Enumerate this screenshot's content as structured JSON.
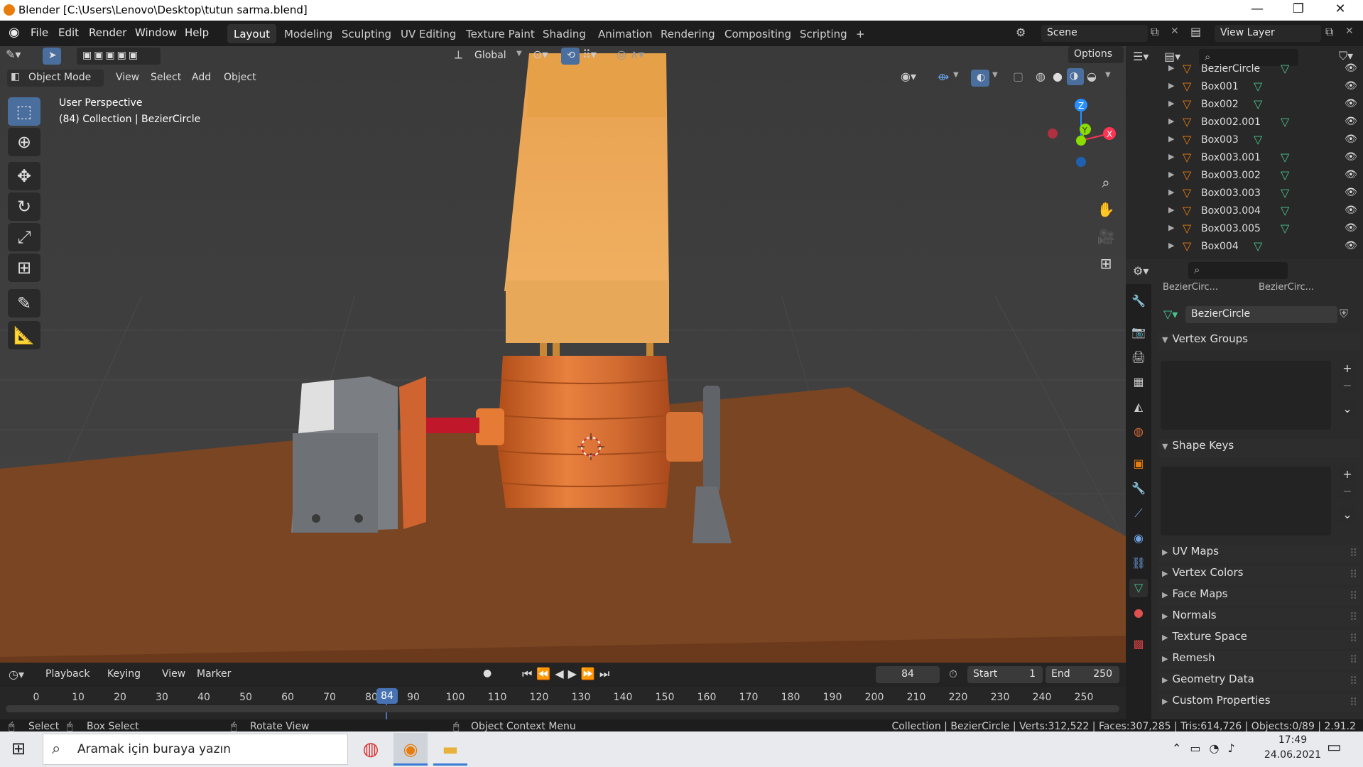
{
  "title_bar": {
    "title": "Blender [C:\\Users\\Lenovo\\Desktop\\tutun sarma.blend]",
    "minimize": "—",
    "maximize": "❐",
    "close": "✕"
  },
  "menu": {
    "items": [
      "File",
      "Edit",
      "Render",
      "Window",
      "Help"
    ]
  },
  "workspaces": [
    "Layout",
    "Modeling",
    "Sculpting",
    "UV Editing",
    "Texture Paint",
    "Shading",
    "Animation",
    "Rendering",
    "Compositing",
    "Scripting"
  ],
  "workspace_add": "+",
  "scene": {
    "name": "Scene",
    "view_layer": "View Layer"
  },
  "viewport": {
    "orientation": "Global",
    "options": "Options",
    "mode": "Object Mode",
    "menus": [
      "View",
      "Select",
      "Add",
      "Object"
    ],
    "info_line1": "User Perspective",
    "info_line2": "(84) Collection | BezierCircle",
    "gizmo": {
      "z": "Z",
      "x": "X",
      "y": "Y"
    }
  },
  "outliner": {
    "items": [
      "BezierCircle",
      "Box001",
      "Box002",
      "Box002.001",
      "Box003",
      "Box003.001",
      "Box003.002",
      "Box003.003",
      "Box003.004",
      "Box003.005",
      "Box004"
    ]
  },
  "properties": {
    "object_name": "BezierCircle",
    "data_name": "BezierCircle",
    "obj_breadcrumb": "BezierCirc...",
    "data_breadcrumb": "BezierCirc...",
    "panels": [
      "Vertex Groups",
      "Shape Keys"
    ],
    "collapsed": [
      "UV Maps",
      "Vertex Colors",
      "Face Maps",
      "Normals",
      "Texture Space",
      "Remesh",
      "Geometry Data",
      "Custom Properties"
    ]
  },
  "timeline": {
    "menus": [
      "Playback",
      "Keying",
      "View",
      "Marker"
    ],
    "current_frame": "84",
    "start_label": "Start",
    "start": "1",
    "end_label": "End",
    "end": "250",
    "ticks": [
      "0",
      "10",
      "20",
      "30",
      "40",
      "50",
      "60",
      "70",
      "80",
      "90",
      "100",
      "110",
      "120",
      "130",
      "140",
      "150",
      "160",
      "170",
      "180",
      "190",
      "200",
      "210",
      "220",
      "230",
      "240",
      "250"
    ],
    "playhead": "84"
  },
  "status": {
    "select": "Select",
    "box_select": "Box Select",
    "rotate": "Rotate View",
    "context": "Object Context Menu",
    "stats": "Collection | BezierCircle | Verts:312,522 | Faces:307,285 | Tris:614,726 | Objects:0/89 | 2.91.2"
  },
  "taskbar": {
    "search_placeholder": "Aramak için buraya yazın",
    "time": "17:49",
    "date": "24.06.2021"
  },
  "colors": {
    "accent": "#4772b3",
    "orange": "#e87d0d",
    "vertex_green": "#4cc38a",
    "gizmo_x": "#ff3352",
    "gizmo_y": "#8bdc00",
    "gizmo_z": "#2890ff"
  }
}
